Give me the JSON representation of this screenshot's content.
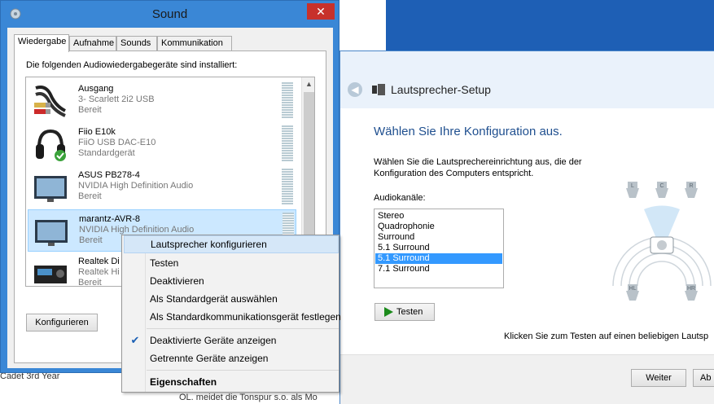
{
  "background": {
    "text_left": "Cadet 3rd Year",
    "text_bottom": "OL. meidet die Tonspur s.o. als Mo"
  },
  "sound_window": {
    "title": "Sound",
    "close_label": "✕",
    "tabs": [
      "Wiedergabe",
      "Aufnahme",
      "Sounds",
      "Kommunikation"
    ],
    "caption": "Die folgenden Audiowiedergabegeräte sind installiert:",
    "devices": [
      {
        "name": "Ausgang",
        "line1": "3- Scarlett 2i2 USB",
        "line2": "Bereit",
        "icon": "rca-cable-icon"
      },
      {
        "name": "Fiio E10k",
        "line1": "FiiO USB DAC-E10",
        "line2": "Standardgerät",
        "icon": "headphones-icon"
      },
      {
        "name": "ASUS PB278-4",
        "line1": "NVIDIA High Definition Audio",
        "line2": "Bereit",
        "icon": "monitor-icon"
      },
      {
        "name": "marantz-AVR-8",
        "line1": "NVIDIA High Definition Audio",
        "line2": "Bereit",
        "icon": "monitor-icon"
      },
      {
        "name": "Realtek Di",
        "line1": "Realtek Hi",
        "line2": "Bereit",
        "icon": "receiver-icon"
      }
    ],
    "configure_label": "Konfigurieren"
  },
  "context_menu": {
    "items": [
      {
        "label": "Lautsprecher konfigurieren"
      },
      {
        "label": "Testen"
      },
      {
        "label": "Deaktivieren"
      },
      {
        "label": "Als Standardgerät auswählen"
      },
      {
        "label": "Als Standardkommunikationsgerät festlegen"
      },
      {
        "label": "Deaktivierte Geräte anzeigen",
        "checked": true
      },
      {
        "label": "Getrennte Geräte anzeigen"
      },
      {
        "label": "Eigenschaften"
      }
    ]
  },
  "setup_window": {
    "title": "Lautsprecher-Setup",
    "heading": "Wählen Sie Ihre Konfiguration aus.",
    "description": "Wählen Sie die Lautsprechereinrichtung aus, die der Konfiguration des Computers entspricht.",
    "channels_label": "Audiokanäle:",
    "channels": [
      "Stereo",
      "Quadrophonie",
      "Surround",
      "5.1 Surround",
      "5.1 Surround",
      "7.1 Surround"
    ],
    "selected_channel": "5.1 Surround",
    "test_label": "Testen",
    "hint": "Klicken Sie zum Testen auf einen beliebigen Lautsp",
    "next_label": "Weiter",
    "cancel_label": "Ab",
    "speaker_labels": [
      "L",
      "C",
      "R",
      "HL",
      "HR"
    ]
  },
  "colors": {
    "title_bar": "#3a87d6",
    "selection": "#3399ff",
    "close_button": "#c7312b",
    "heading_blue": "#1f4f8f"
  }
}
